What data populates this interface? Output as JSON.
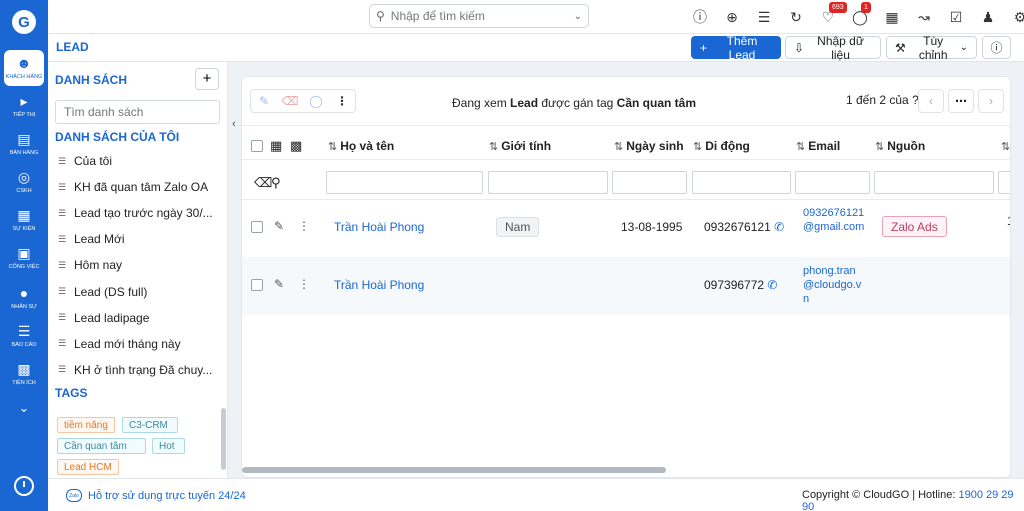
{
  "header": {
    "search_placeholder": "Nhập để tìm kiếm",
    "notifications_count": "693",
    "chat_count": "1"
  },
  "nav": {
    "items": [
      {
        "label": "KHÁCH HÀNG",
        "icon": "customers-icon"
      },
      {
        "label": "TIẾP THỊ",
        "icon": "megaphone-icon"
      },
      {
        "label": "BÁN HÀNG",
        "icon": "cart-icon"
      },
      {
        "label": "CSKH",
        "icon": "support-icon"
      },
      {
        "label": "SỰ KIỆN",
        "icon": "calendar-icon"
      },
      {
        "label": "CÔNG VIỆC",
        "icon": "briefcase-icon"
      },
      {
        "label": "NHÂN SỰ",
        "icon": "person-icon"
      },
      {
        "label": "BÁO CÁO",
        "icon": "report-icon"
      },
      {
        "label": "TIỆN ÍCH",
        "icon": "utilities-icon"
      }
    ]
  },
  "toolbar": {
    "page_title": "LEAD",
    "add_lead": "Thêm Lead",
    "import": "Nhập dữ liệu",
    "customize": "Tùy chỉnh"
  },
  "lists": {
    "heading": "DANH SÁCH",
    "filter_placeholder": "Tìm danh sách",
    "my_lists_heading": "DANH SÁCH CỦA TÔI",
    "items": [
      "Của tôi",
      "KH đã quan tâm Zalo OA",
      "Lead tạo trước ngày 30/...",
      "Lead Mới",
      "Hôm nay",
      "Lead (DS full)",
      "Lead ladipage",
      "Lead mới tháng này",
      "KH ở tình trạng Đã chuy..."
    ],
    "tags_heading": "TAGS",
    "tags": [
      "tiềm năng",
      "C3-CRM",
      "Cần quan tâm",
      "Hot",
      "Lead HCM"
    ]
  },
  "main": {
    "viewing_prefix": "Đang xem ",
    "viewing_module": "Lead",
    "viewing_middle": " được gán tag ",
    "viewing_tag": "Cần quan tâm",
    "pager": "1 đến 2 của",
    "pager_unknown": "?",
    "columns": [
      "Họ và tên",
      "Giới tính",
      "Ngày sinh",
      "Di động",
      "Email",
      "Nguồn"
    ],
    "rows": [
      {
        "name": "Trần Hoài Phong",
        "gender": "Nam",
        "birthday": "13-08-1995",
        "mobile": "0932676121",
        "email": "0932676121@gmail.com",
        "source": "Zalo Ads",
        "extra": "1"
      },
      {
        "name": "Trần Hoài Phong",
        "gender": "",
        "birthday": "",
        "mobile": "097396772",
        "email": "phong.tran@cloudgo.vn",
        "source": "",
        "extra": ""
      }
    ]
  },
  "footer": {
    "support": "Hỗ trợ sử dụng trực tuyến 24/24",
    "copyright": "Copyright © CloudGO | Hotline: ",
    "hotline": "1900 29 29 90"
  },
  "colors": {
    "primary": "#1a66d2",
    "source_tag": "#c03a62"
  }
}
